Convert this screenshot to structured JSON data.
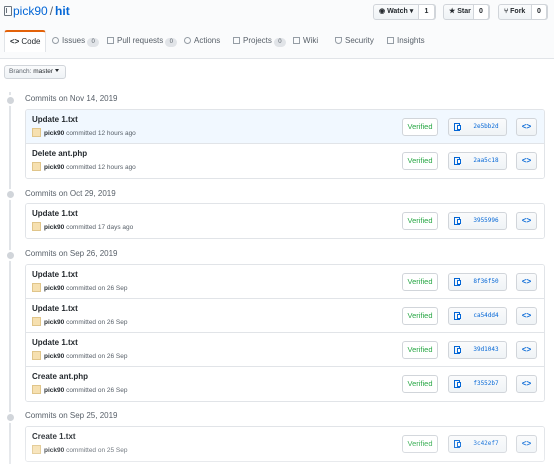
{
  "repo": {
    "owner": "pick90",
    "separator": "/",
    "name": "hit"
  },
  "actions": {
    "watch": {
      "label": "Watch",
      "count": "1"
    },
    "star": {
      "label": "Star",
      "count": "0"
    },
    "fork": {
      "label": "Fork",
      "count": "0"
    }
  },
  "tabs": [
    {
      "label": "Code",
      "count": null,
      "icon": "code-icon",
      "selected": true
    },
    {
      "label": "Issues",
      "count": "0",
      "icon": "issue-icon"
    },
    {
      "label": "Pull requests",
      "count": "0",
      "icon": "pull-request-icon"
    },
    {
      "label": "Actions",
      "count": null,
      "icon": "play-icon"
    },
    {
      "label": "Projects",
      "count": "0",
      "icon": "project-icon"
    },
    {
      "label": "Wiki",
      "count": null,
      "icon": "book-icon"
    },
    {
      "label": "Security",
      "count": null,
      "icon": "shield-icon"
    },
    {
      "label": "Insights",
      "count": null,
      "icon": "graph-icon"
    }
  ],
  "branch": {
    "prefix": "Branch:",
    "name": "master"
  },
  "groups": [
    {
      "title": "Commits on Nov 14, 2019",
      "commits": [
        {
          "message": "Update 1.txt",
          "author": "pick90",
          "meta": "committed 12 hours ago",
          "verified": "Verified",
          "sha": "2e5bb2d"
        },
        {
          "message": "Delete ant.php",
          "author": "pick90",
          "meta": "committed 12 hours ago",
          "verified": "Verified",
          "sha": "2aa5c18"
        }
      ]
    },
    {
      "title": "Commits on Oct 29, 2019",
      "commits": [
        {
          "message": "Update 1.txt",
          "author": "pick90",
          "meta": "committed 17 days ago",
          "verified": "Verified",
          "sha": "3955996"
        }
      ]
    },
    {
      "title": "Commits on Sep 26, 2019",
      "commits": [
        {
          "message": "Update 1.txt",
          "author": "pick90",
          "meta": "committed on 26 Sep",
          "verified": "Verified",
          "sha": "8f36f50"
        },
        {
          "message": "Update 1.txt",
          "author": "pick90",
          "meta": "committed on 26 Sep",
          "verified": "Verified",
          "sha": "ca54dd4"
        },
        {
          "message": "Update 1.txt",
          "author": "pick90",
          "meta": "committed on 26 Sep",
          "verified": "Verified",
          "sha": "39d1043"
        },
        {
          "message": "Create ant.php",
          "author": "pick90",
          "meta": "committed on 26 Sep",
          "verified": "Verified",
          "sha": "f3552b7"
        }
      ]
    },
    {
      "title": "Commits on Sep 25, 2019",
      "commits": [
        {
          "message": "Create 1.txt",
          "author": "pick90",
          "meta": "committed on 25 Sep",
          "verified": "Verified",
          "sha": "3c42ef7"
        }
      ]
    }
  ],
  "browse_label": "<>"
}
